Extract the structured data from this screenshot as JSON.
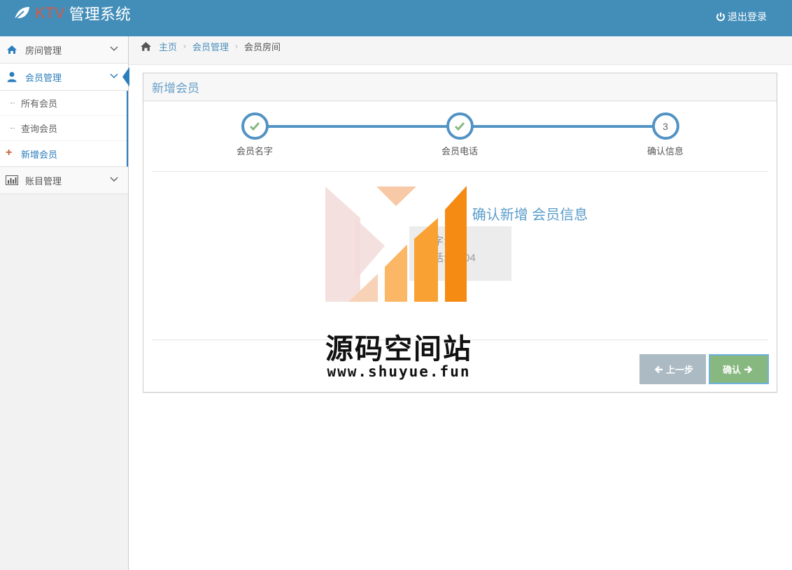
{
  "header": {
    "brand_ktv": "KTV",
    "brand_title": "管理系统",
    "logout_label": "退出登录"
  },
  "sidebar": {
    "items": [
      {
        "label": "房间管理"
      },
      {
        "label": "会员管理",
        "sub": [
          "所有会员",
          "查询会员",
          "新增会员"
        ]
      },
      {
        "label": "账目管理"
      }
    ]
  },
  "breadcrumb": {
    "home": "主页",
    "section": "会员管理",
    "current": "会员房间"
  },
  "widget": {
    "title": "新增会员",
    "steps": [
      {
        "label": "会员名字",
        "state": "done"
      },
      {
        "label": "会员电话",
        "state": "done"
      },
      {
        "label": "确认信息",
        "number": "3"
      }
    ],
    "confirm_title": "确认新增 会员信息",
    "info_line1": "字: 三",
    "info_line2": "话: 2  404",
    "prev_label": "上一步",
    "next_label": "确认"
  },
  "watermark": {
    "name": "源码空间站",
    "url": "www.shuyue.fun"
  },
  "colors": {
    "header_bg": "#438eb9",
    "accent_blue": "#2b7dbc",
    "step_blue": "#5293c4",
    "check_green": "#87b87f",
    "brand_red": "#d15b47"
  }
}
